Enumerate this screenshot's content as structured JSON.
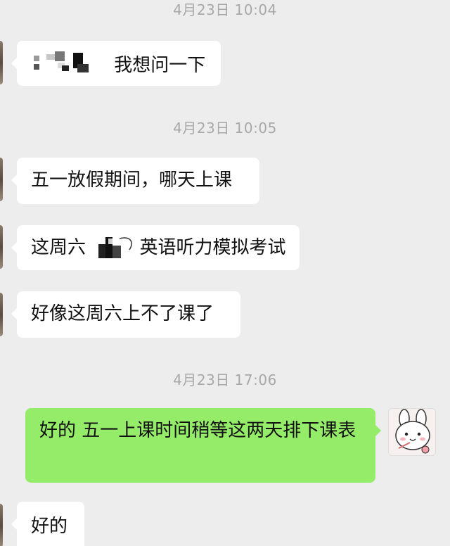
{
  "chat": {
    "timestamps": [
      "4月23日 10:04",
      "4月23日 10:05",
      "4月23日 17:06"
    ],
    "messages": [
      {
        "side": "left",
        "text": "我想问一下"
      },
      {
        "side": "left",
        "text": "五一放假期间，哪天上课"
      },
      {
        "side": "left",
        "text_before": "这周六",
        "text_after": "英语听力模拟考试"
      },
      {
        "side": "left",
        "text": "好像这周六上不了课了"
      },
      {
        "side": "right",
        "text": "好的  五一上课时间稍等这两天排下课表"
      },
      {
        "side": "left",
        "text": "好的"
      }
    ]
  },
  "colors": {
    "background": "#ededed",
    "bubble_left": "#ffffff",
    "bubble_right": "#95ec69",
    "timestamp": "#a8a8a8"
  },
  "icons": {
    "left_avatar": "contact-avatar-icon",
    "right_avatar": "bunny-sticker-avatar-icon",
    "redaction": "redacted-mosaic-icon"
  }
}
